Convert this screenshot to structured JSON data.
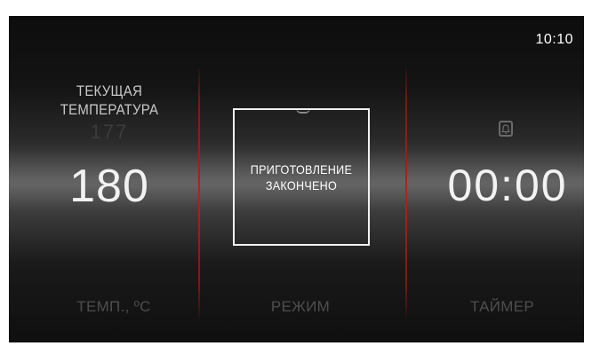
{
  "status_bar": {
    "time": "10:10"
  },
  "temperature": {
    "label": "ТЕКУЩАЯ ТЕМПЕРАТУРА",
    "current_value": "177",
    "set_value": "180"
  },
  "status": {
    "message": "ПРИГОТОВЛЕНИЕ ЗАКОНЧЕНО"
  },
  "timer": {
    "value": "00:00",
    "icon": "bell-icon"
  },
  "tabs": [
    {
      "label": "ТЕМП., ºC"
    },
    {
      "label": "РЕЖИМ"
    },
    {
      "label": "ТАЙМЕР"
    }
  ],
  "colors": {
    "divider": "#a52a1c",
    "text_primary": "#f2f2f2",
    "text_muted": "#4e4e4e"
  }
}
